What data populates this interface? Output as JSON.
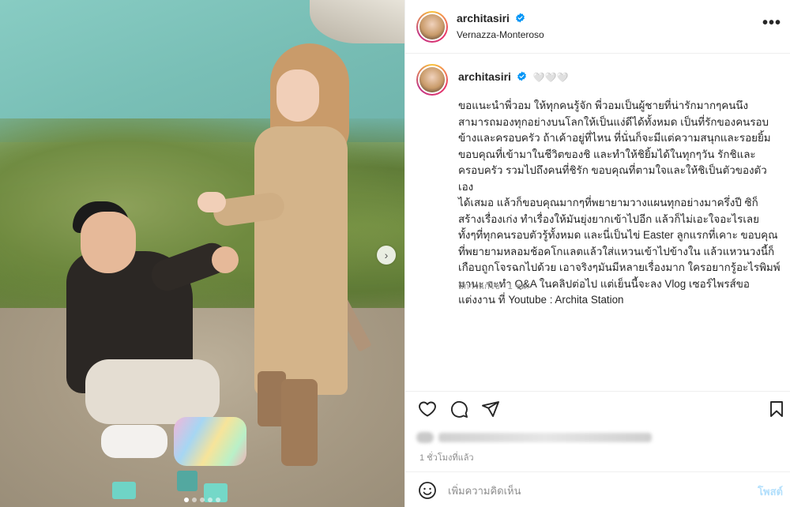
{
  "post": {
    "username": "architasiri",
    "location": "Vernazza-Monteroso",
    "more_icon": "•••",
    "verified_color": "#0095f6"
  },
  "caption": {
    "username": "architasiri",
    "emojis": "🤍🤍🤍",
    "text": "ขอแนะนำพี่วอม ให้ทุกคนรู้จัก พี่วอมเป็นผู้ชายที่น่ารักมากๆคนนึง\nสามารถมองทุกอย่างบนโลกให้เป็นแง่ดีได้ทั้งหมด เป็นที่รักของคนรอบ\nข้างและครอบครัว ถ้าเค้าอยู่ที่ไหน ที่นั่นก็จะมีแต่ความสนุกและรอยยิ้ม\nขอบคุณที่เข้ามาในชีวิตของชิ และทำให้ชิยิ้มได้ในทุกๆวัน รักชิและ\nครอบครัว รวมไปถึงคนที่ชิรัก ขอบคุณที่ตามใจและให้ชิเป็นตัวของตัวเอง\nได้เสมอ แล้วก็ขอบคุณมากๆที่พยายามวางแผนทุกอย่างมาครึ่งปี ซิก็\nสร้างเรื่องเก่ง ทำเรื่องให้มันยุ่งยากเข้าไปอีก แล้วก็ไม่เอะใจอะไรเลย\nทั้งๆที่ทุกคนรอบตัวรู้ทั้งหมด และนี่เป็นไข่ Easter ลูกแรกที่เคาะ ขอบคุณ\nที่พยายามหลอมช้อคโกแลตแล้วใส่แหวนเข้าไปข้างใน แล้วแหวนวงนี้ก็\nเกือบถูกโจรฉกไปด้วย เอาจริงๆมันมีหลายเรื่องมาก ใครอยากรู้อะไรพิมพ์\nมานะ จะทำ Q&A ในคลิปต่อไป แต่เย็นนี้จะลง Vlog เซอร์ไพรส์ขอ\nแต่งงาน ที่ Youtube : Archita Station",
    "meta": "มีการแก้ไข · 1 ชม."
  },
  "actions": {
    "like_icon": "heart-icon",
    "comment_icon": "comment-icon",
    "share_icon": "share-icon",
    "save_icon": "bookmark-icon"
  },
  "likes": {
    "time_ago": "1 ชั่วโมงที่แล้ว"
  },
  "comment": {
    "placeholder": "เพิ่มความคิดเห็น",
    "post_label": "โพสต์",
    "post_color": "#b2dffc"
  },
  "carousel": {
    "next_glyph": "›",
    "total_slides": 5,
    "active_slide": 1
  }
}
